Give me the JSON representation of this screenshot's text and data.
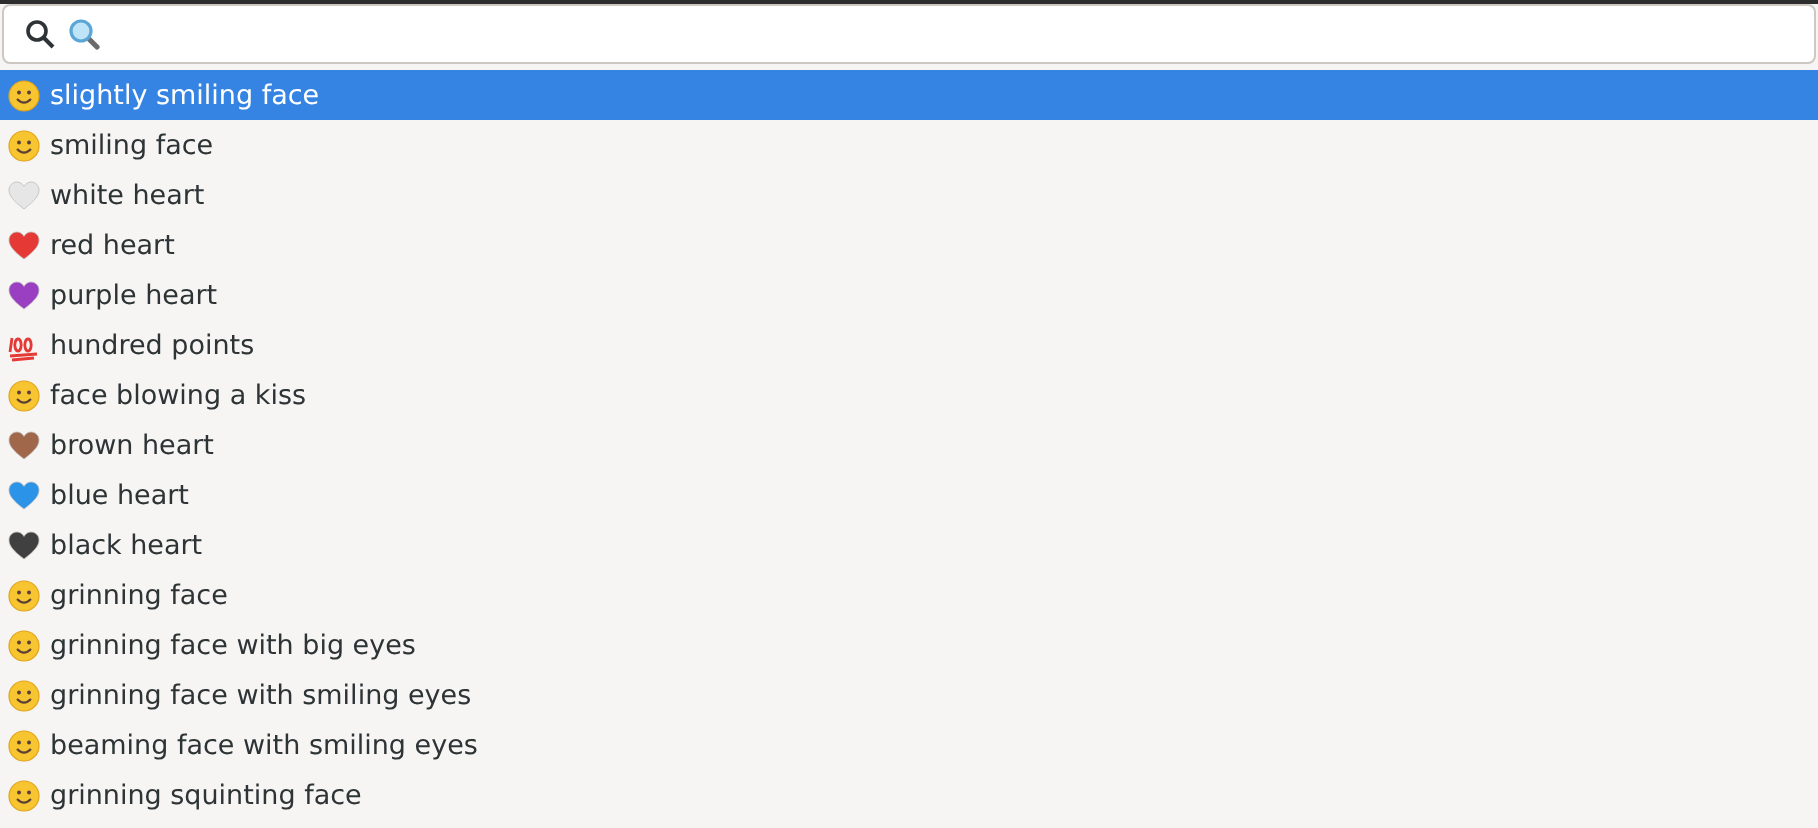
{
  "search": {
    "kind": "search"
  },
  "results": [
    {
      "label": "slightly smiling face",
      "kind": "face",
      "selected": true
    },
    {
      "label": "smiling face",
      "kind": "face",
      "selected": false
    },
    {
      "label": "white heart",
      "kind": "heart",
      "color": "#e6e6e6",
      "selected": false
    },
    {
      "label": "red heart",
      "kind": "heart",
      "color": "#e53935",
      "selected": false
    },
    {
      "label": "purple heart",
      "kind": "heart",
      "color": "#9b3fc2",
      "selected": false
    },
    {
      "label": "hundred points",
      "kind": "hundred",
      "selected": false
    },
    {
      "label": "face blowing a kiss",
      "kind": "face",
      "selected": false
    },
    {
      "label": "brown heart",
      "kind": "heart",
      "color": "#a0674b",
      "selected": false
    },
    {
      "label": "blue heart",
      "kind": "heart",
      "color": "#2b93e8",
      "selected": false
    },
    {
      "label": "black heart",
      "kind": "heart",
      "color": "#404040",
      "selected": false
    },
    {
      "label": "grinning face",
      "kind": "face",
      "selected": false
    },
    {
      "label": "grinning face with big eyes",
      "kind": "face",
      "selected": false
    },
    {
      "label": "grinning face with smiling eyes",
      "kind": "face",
      "selected": false
    },
    {
      "label": "beaming face with smiling eyes",
      "kind": "face",
      "selected": false
    },
    {
      "label": "grinning squinting face",
      "kind": "face",
      "selected": false
    }
  ]
}
